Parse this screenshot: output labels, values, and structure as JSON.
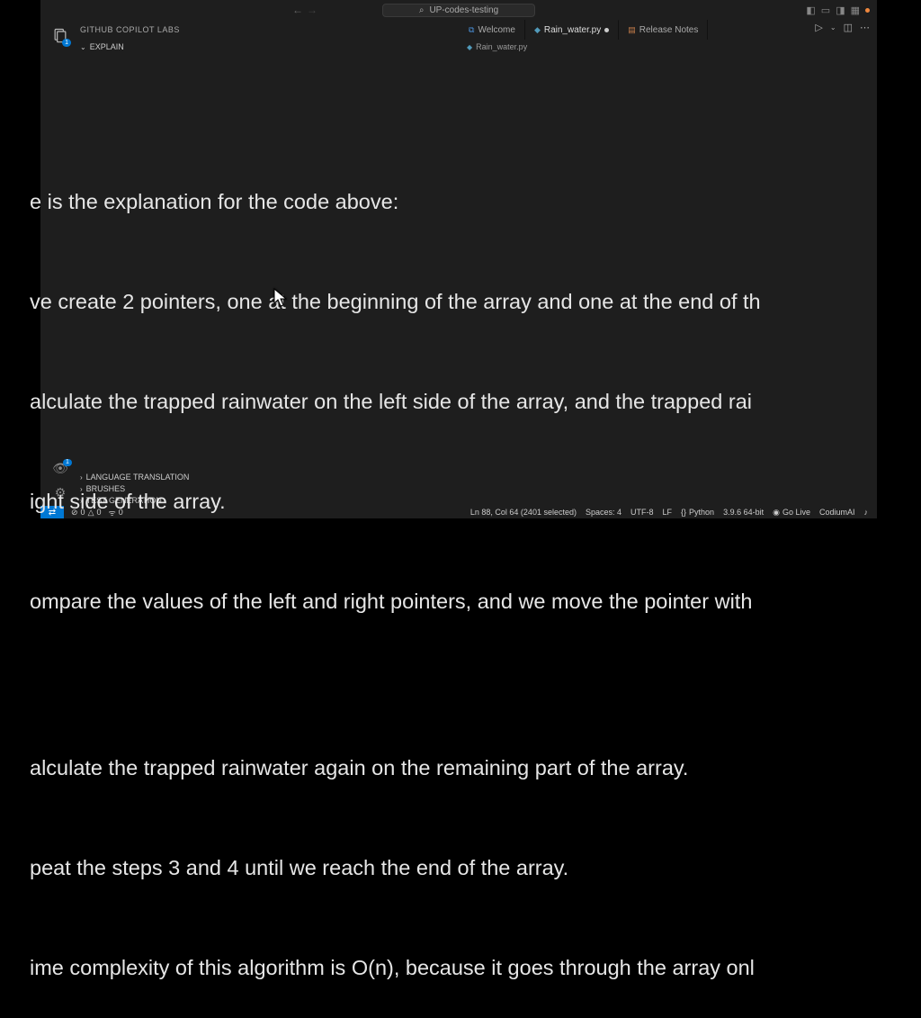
{
  "titlebar": {
    "search_placeholder": "UP-codes-testing"
  },
  "sidebar": {
    "title": "GITHUB COPILOT LABS",
    "explain_label": "EXPLAIN",
    "sections": [
      {
        "label": "LANGUAGE TRANSLATION"
      },
      {
        "label": "BRUSHES"
      },
      {
        "label": "TEST GENERATION"
      }
    ]
  },
  "tabs": [
    {
      "label": "Welcome",
      "icon_color": "#4a90d9",
      "active": false,
      "dirty": false
    },
    {
      "label": "Rain_water.py",
      "icon_color": "#519aba",
      "active": true,
      "dirty": true
    },
    {
      "label": "Release Notes",
      "icon_color": "#c97f4b",
      "active": false,
      "dirty": false
    }
  ],
  "breadcrumb": {
    "file": "Rain_water.py"
  },
  "explanation": {
    "lines": [
      "e is the explanation for the code above:",
      "ve create 2 pointers, one at the beginning of the array and one at the end of th",
      "alculate the trapped rainwater on the left side of the array, and the trapped rai",
      "ight side of the array.",
      "ompare the values of the left and right pointers, and we move the pointer with ",
      "",
      "alculate the trapped rainwater again on the remaining part of the array.",
      "peat the steps 3 and 4 until we reach the end of the array.",
      "ime complexity of this algorithm is O(n), because it goes through the array onl"
    ]
  },
  "status": {
    "problems": "0",
    "warnings": "0",
    "ports": "0",
    "cursor": "Ln 88, Col 64 (2401 selected)",
    "spaces": "Spaces: 4",
    "encoding": "UTF-8",
    "eol": "LF",
    "lang": "Python",
    "interpreter": "3.9.6 64-bit",
    "golive": "Go Live",
    "codium": "CodiumAI"
  }
}
